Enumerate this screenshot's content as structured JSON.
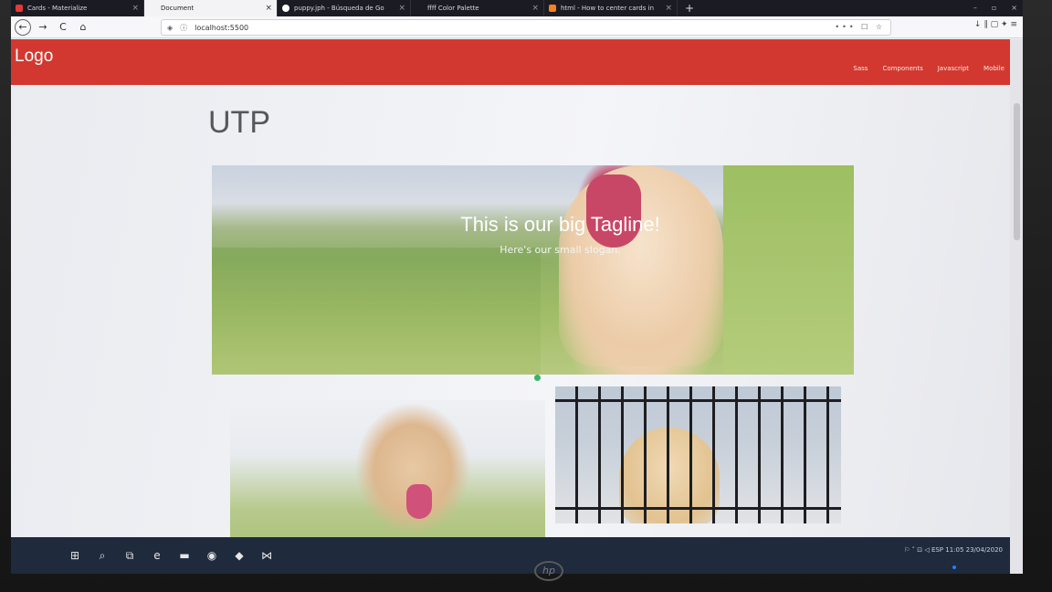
{
  "browser": {
    "tabs": [
      {
        "label": "Cards - Materialize",
        "favicon_color": "#e53935",
        "active": false
      },
      {
        "label": "Document",
        "favicon_color": "#f3f3f6",
        "active": true
      },
      {
        "label": "puppy.jph - Búsqueda de Go",
        "favicon_color": "#ffffff",
        "active": false
      },
      {
        "label": "ffff Color Palette",
        "favicon_color": "#1b1b24",
        "active": false
      },
      {
        "label": "html - How to center cards in",
        "favicon_color": "#f48024",
        "active": false
      }
    ],
    "tab_close": "×",
    "new_tab": "+",
    "window_controls": {
      "minimize": "–",
      "maximize": "▫",
      "close": "×"
    },
    "toolbar": {
      "back": "←",
      "forward": "→",
      "reload": "C",
      "home": "⌂"
    },
    "url": "localhost:5500",
    "url_right_icons": "••• ☐ ☆",
    "toolbar_right_icons": "↓ ∥ ▢ ✦ ≡"
  },
  "site": {
    "logo": "Logo",
    "nav": [
      "Sass",
      "Components",
      "Javascript",
      "Mobile"
    ],
    "heading": "UTP",
    "carousel": {
      "title": "This is our big Tagline!",
      "subtitle": "Here's our small slogan."
    },
    "accent_color": "#d2382f",
    "indicator_color": "#3bb36b"
  },
  "taskbar": {
    "items": [
      "⊞",
      "⌕",
      "⧉",
      "e",
      "▬",
      "◉",
      "◆",
      "⋈"
    ],
    "tray": "⚐ ˄ ⊡ ◁ ESP 11:05 23/04/2020"
  },
  "monitor": {
    "brand": "hp"
  }
}
